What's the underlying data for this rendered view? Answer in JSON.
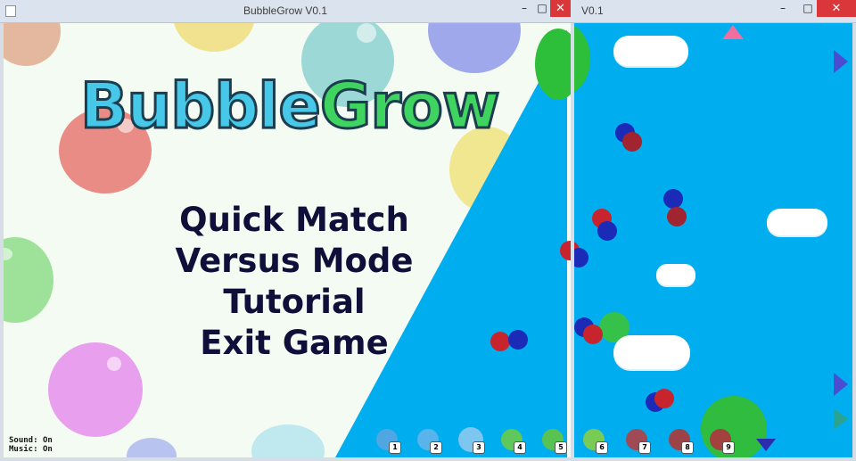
{
  "left_window": {
    "title": "BubbleGrow V0.1",
    "minimize_glyph": "–",
    "maximize_glyph": "□",
    "close_glyph": "✕"
  },
  "right_window": {
    "title": "V0.1",
    "minimize_glyph": "–",
    "maximize_glyph": "□",
    "close_glyph": "✕"
  },
  "logo": {
    "part1": "Bubble",
    "part2": "Grow",
    "colors": {
      "part1": "#47c8e9",
      "part2": "#3fd35f",
      "outline": "#1b3d4d"
    }
  },
  "menu": {
    "items": [
      "Quick Match",
      "Versus Mode",
      "Tutorial",
      "Exit Game"
    ]
  },
  "settings_status": {
    "sound_label": "Sound:",
    "sound_value": "On",
    "music_label": "Music:",
    "music_value": "On"
  },
  "hud": {
    "slots": [
      "1",
      "2",
      "3",
      "4",
      "5",
      "6",
      "7",
      "8",
      "9"
    ]
  },
  "colors": {
    "menu_background": "#f4fbf2",
    "game_sky": "#00aef0",
    "close_button": "#d9373a",
    "menu_text": "#0f0f3a"
  },
  "icons": [
    "app-icon",
    "minimize-icon",
    "maximize-icon",
    "close-icon",
    "arrow-right-icon",
    "arrow-up-icon",
    "arrow-down-icon"
  ]
}
